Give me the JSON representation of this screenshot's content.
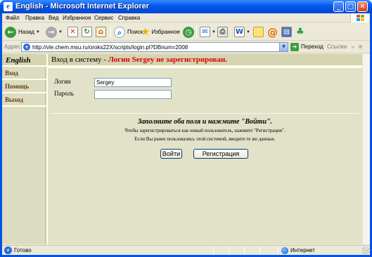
{
  "window": {
    "title": "English - Microsoft Internet Explorer"
  },
  "menubar": {
    "items": [
      "Файл",
      "Правка",
      "Вид",
      "Избранное",
      "Сервис",
      "Справка"
    ]
  },
  "toolbar": {
    "back_label": "Назад",
    "search_label": "Поиск",
    "favorites_label": "Избранное"
  },
  "addressbar": {
    "label": "Адрес:",
    "url": "http://vle.chem.msu.ru/oroks22X/scripts/login.pl?DBnum=2008",
    "go_label": "Переход",
    "links_label": "Ссылки"
  },
  "sidebar": {
    "title": "English",
    "links": [
      "Вход",
      "Помощь",
      "Выход"
    ]
  },
  "page": {
    "header_prefix": "Вход в систему - ",
    "header_warning": "Логин Sergey не зарегистрирован.",
    "login_label": "Логин",
    "login_value": "Sergey",
    "password_label": "Пароль",
    "password_value": "",
    "notice_main": "Заполните оба поля и нажмите \"Войти\".",
    "notice_line1": "Чтобы зарегистрироваться как новый пользователь, нажмите \"Регистрация\".",
    "notice_line2": "Если Вы ранее пользовались этой системой, вводите те же данные.",
    "login_button": "Войти",
    "register_button": "Регистрация"
  },
  "statusbar": {
    "status": "Готово",
    "zone": "Интернет"
  },
  "colors": {
    "titlebar": "#0058ee",
    "sidebar_bg": "#dcdcc0",
    "header_bg": "#d4d4b0",
    "warning": "#e00000",
    "page_bg": "#fffff0"
  }
}
